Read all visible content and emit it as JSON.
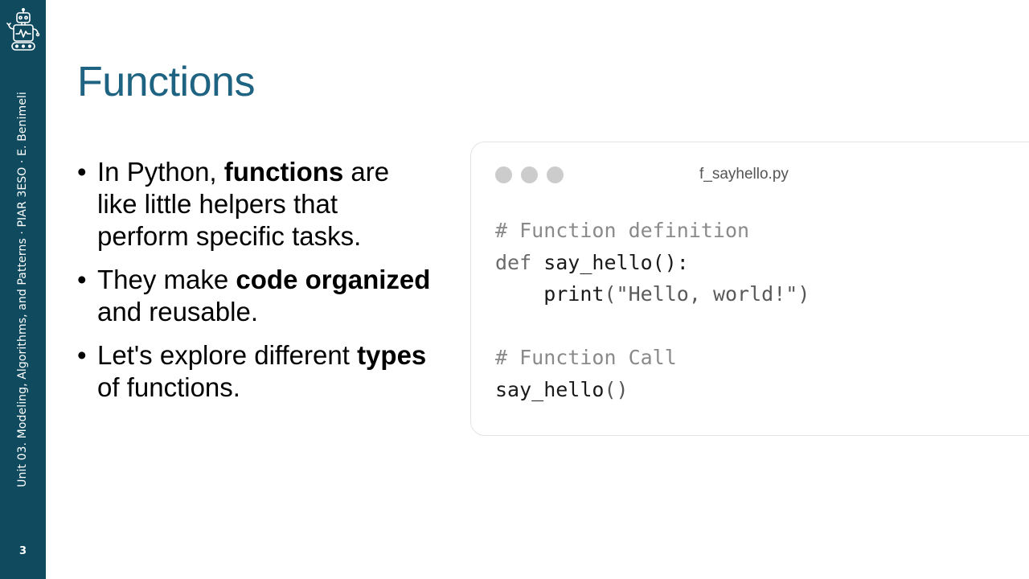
{
  "sidebar": {
    "vertical_text": "Unit 03. Modeling, Algorithms, and Patterns · PIAR 3ESO · E. Benimeli",
    "page_number": "3",
    "logo_icon": "robot-icon",
    "background_color": "#0f4a5f"
  },
  "slide": {
    "title": "Functions",
    "title_color": "#1e6381"
  },
  "bullets": [
    {
      "parts": [
        {
          "text": "In Python, ",
          "bold": false
        },
        {
          "text": "functions",
          "bold": true
        },
        {
          "text": " are like little helpers that perform specific tasks.",
          "bold": false
        }
      ]
    },
    {
      "parts": [
        {
          "text": "They make ",
          "bold": false
        },
        {
          "text": "code organized",
          "bold": true
        },
        {
          "text": " and reusable.",
          "bold": false
        }
      ]
    },
    {
      "parts": [
        {
          "text": "Let's explore different ",
          "bold": false
        },
        {
          "text": "types",
          "bold": true
        },
        {
          "text": " of functions.",
          "bold": false
        }
      ]
    }
  ],
  "code_window": {
    "filename": "f_sayhello.py",
    "lines": [
      [
        {
          "t": "# Function definition",
          "c": "comment"
        }
      ],
      [
        {
          "t": "def",
          "c": "kw"
        },
        {
          "t": " say_hello",
          "c": "name"
        },
        {
          "t": "():",
          "c": "name"
        }
      ],
      [
        {
          "t": "    print",
          "c": "name"
        },
        {
          "t": "(",
          "c": "punc"
        },
        {
          "t": "\"Hello, world!\"",
          "c": "str"
        },
        {
          "t": ")",
          "c": "punc"
        }
      ],
      [
        {
          "t": "",
          "c": "name"
        }
      ],
      [
        {
          "t": "# Function Call",
          "c": "comment"
        }
      ],
      [
        {
          "t": "say_hello",
          "c": "name"
        },
        {
          "t": "()",
          "c": "punc"
        }
      ]
    ]
  }
}
